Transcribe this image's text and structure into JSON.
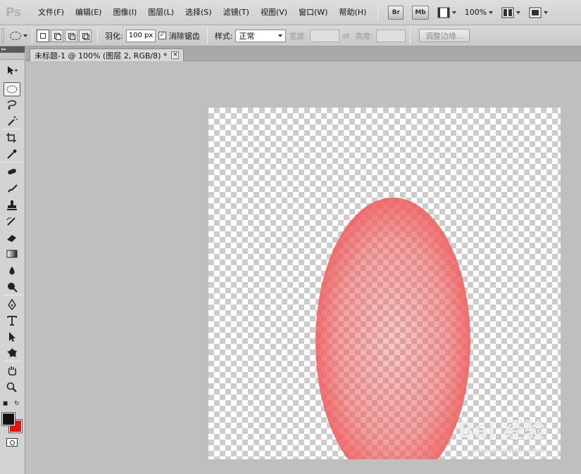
{
  "app": {
    "logo": "Ps"
  },
  "menu": {
    "items": [
      "文件(F)",
      "编辑(E)",
      "图像(I)",
      "图层(L)",
      "选择(S)",
      "滤镜(T)",
      "视图(V)",
      "窗口(W)",
      "帮助(H)"
    ],
    "bridge": "Br",
    "mini_bridge": "Mb",
    "zoom": "100%"
  },
  "options": {
    "feather_label": "羽化:",
    "feather_value": "100 px",
    "antialias_checked": "✓",
    "antialias_label": "消除锯齿",
    "style_label": "样式:",
    "style_value": "正常",
    "width_label": "宽度:",
    "height_label": "高度:",
    "refine_edge": "调整边缘..."
  },
  "document": {
    "tab_title": "未标题-1 @ 100% (图层 2, RGB/8) *",
    "close": "×"
  },
  "tools_panel": {
    "header": "▸▸"
  },
  "colors": {
    "foreground": "#111111",
    "background": "#e81010",
    "ellipse_fill": "#f06060"
  },
  "watermark": {
    "main": "Bai 经验",
    "sub": "jingyan.baidu.com"
  }
}
